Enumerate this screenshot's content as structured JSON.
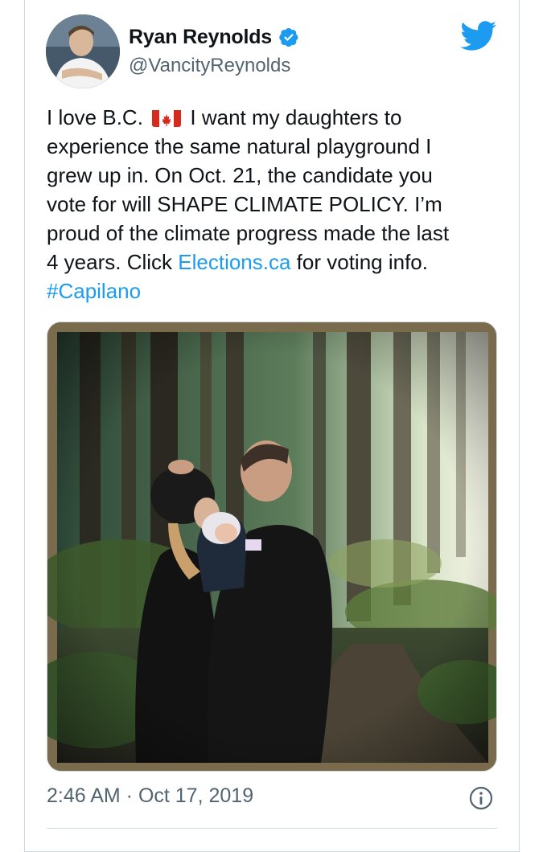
{
  "author": {
    "name": "Ryan Reynolds",
    "handle": "@VancityReynolds",
    "verified_icon": "verified-badge-icon",
    "avatar_icon": "avatar"
  },
  "brand": {
    "logo_icon": "twitter-bird-icon",
    "color": "#1d9bf0"
  },
  "tweet": {
    "lines": [
      {
        "parts": [
          "I love B.C. ",
          "",
          " I want my daughters to"
        ]
      },
      {
        "text": "experience the same natural playground I"
      },
      {
        "text": "grew up in. On Oct. 21, the candidate you"
      },
      {
        "text": "vote for will SHAPE CLIMATE POLICY. I’m"
      },
      {
        "text": "proud of the climate progress made the last"
      },
      {
        "before_link": "4 years. Click ",
        "link": "Elections.ca",
        "after_link": " for voting info."
      },
      {
        "hashtag": "#Capilano"
      }
    ],
    "emoji": "canada-flag-icon",
    "media": "photo of a family in a forest"
  },
  "meta": {
    "timestamp": "2:46 AM · Oct 17, 2019",
    "info_icon": "info-icon"
  },
  "colors": {
    "text": "#0f1419",
    "secondary": "#536471",
    "link": "#1d9bf0",
    "border": "#cfd9de"
  }
}
